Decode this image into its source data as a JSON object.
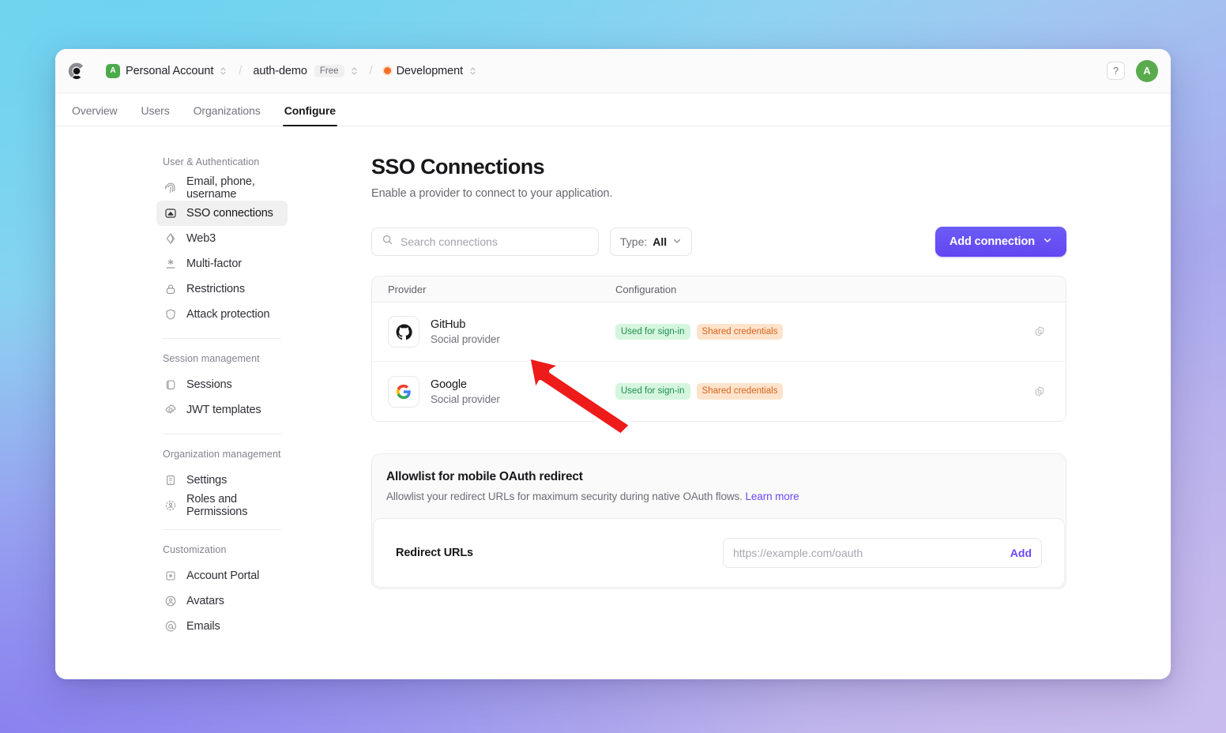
{
  "window": {
    "logo_icon": "clerk-logo-icon"
  },
  "topbar": {
    "account": {
      "badge": "A",
      "label": "Personal Account"
    },
    "application": {
      "label": "auth-demo",
      "plan": "Free"
    },
    "environment": {
      "label": "Development",
      "dot_color": "#f2712a"
    },
    "separator": "/",
    "help_label": "?",
    "avatar_initial": "A"
  },
  "tabs": [
    {
      "label": "Overview",
      "active": false
    },
    {
      "label": "Users",
      "active": false
    },
    {
      "label": "Organizations",
      "active": false
    },
    {
      "label": "Configure",
      "active": true
    }
  ],
  "sidebar": {
    "groups": [
      {
        "title": "User & Authentication",
        "items": [
          {
            "label": "Email, phone, username",
            "icon": "fingerprint-icon",
            "active": false
          },
          {
            "label": "SSO connections",
            "icon": "sso-connections-icon",
            "active": true
          },
          {
            "label": "Web3",
            "icon": "web3-icon",
            "active": false
          },
          {
            "label": "Multi-factor",
            "icon": "multi-factor-icon",
            "active": false
          },
          {
            "label": "Restrictions",
            "icon": "lock-icon",
            "active": false
          },
          {
            "label": "Attack protection",
            "icon": "shield-icon",
            "active": false
          }
        ]
      },
      {
        "title": "Session management",
        "items": [
          {
            "label": "Sessions",
            "icon": "sessions-icon",
            "active": false
          },
          {
            "label": "JWT templates",
            "icon": "gear-icon",
            "active": false
          }
        ]
      },
      {
        "title": "Organization management",
        "items": [
          {
            "label": "Settings",
            "icon": "building-icon",
            "active": false
          },
          {
            "label": "Roles and Permissions",
            "icon": "roles-icon",
            "active": false
          }
        ]
      },
      {
        "title": "Customization",
        "items": [
          {
            "label": "Account Portal",
            "icon": "portal-icon",
            "active": false
          },
          {
            "label": "Avatars",
            "icon": "avatar-icon",
            "active": false
          },
          {
            "label": "Emails",
            "icon": "at-icon",
            "active": false
          }
        ]
      }
    ]
  },
  "main": {
    "title": "SSO Connections",
    "subtitle": "Enable a provider to connect to your application.",
    "search": {
      "placeholder": "Search connections",
      "value": ""
    },
    "type_filter": {
      "label": "Type:",
      "value": "All"
    },
    "add_button": {
      "label": "Add connection"
    },
    "table": {
      "columns": [
        "Provider",
        "Configuration"
      ],
      "rows": [
        {
          "provider": "GitHub",
          "kind": "Social provider",
          "logo_icon": "github-icon",
          "badges": [
            {
              "label": "Used for sign-in",
              "tone": "green"
            },
            {
              "label": "Shared credentials",
              "tone": "orange"
            }
          ],
          "action_icon": "gear-icon"
        },
        {
          "provider": "Google",
          "kind": "Social provider",
          "logo_icon": "google-icon",
          "badges": [
            {
              "label": "Used for sign-in",
              "tone": "green"
            },
            {
              "label": "Shared credentials",
              "tone": "orange"
            }
          ],
          "action_icon": "gear-icon"
        }
      ]
    },
    "allowlist": {
      "title": "Allowlist for mobile OAuth redirect",
      "description": "Allowlist your redirect URLs for maximum security during native OAuth flows.",
      "link_label": "Learn more",
      "field_label": "Redirect URLs",
      "input_placeholder": "https://example.com/oauth",
      "input_value": "",
      "add_label": "Add"
    }
  },
  "annotation": {
    "arrow_color": "#ee1b1b",
    "arrow_outline": "#ffffff"
  },
  "colors": {
    "accent": "#6c47ff",
    "badge_green_bg": "#d6f5df",
    "badge_green_text": "#1d9050",
    "badge_orange_bg": "#fde3cc",
    "badge_orange_text": "#d9631a",
    "avatar_green": "#5aab4e"
  }
}
